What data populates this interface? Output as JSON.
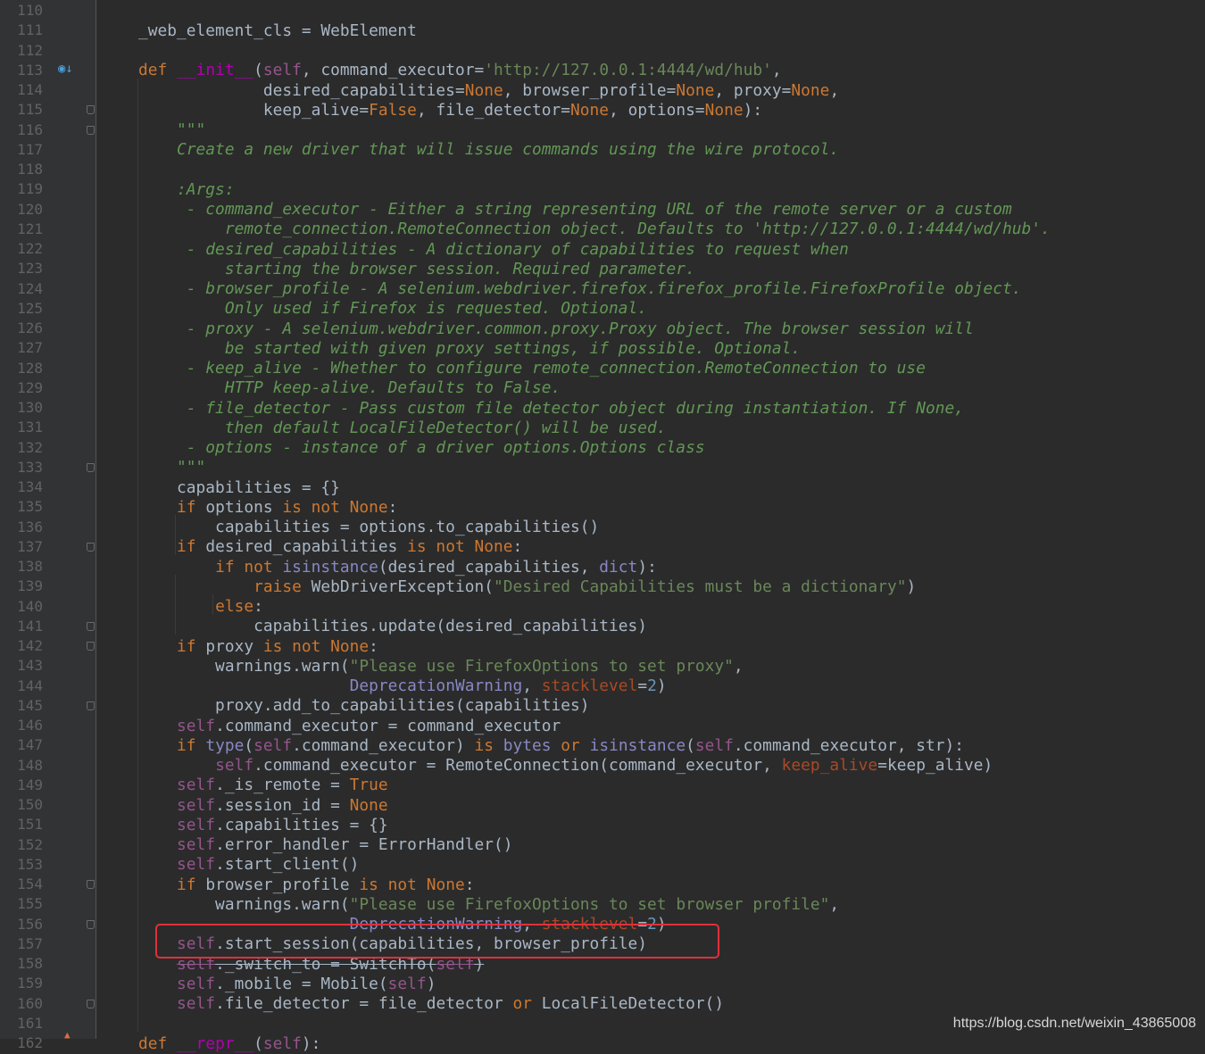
{
  "editor": {
    "language": "python",
    "theme": "darcula",
    "highlighted_line": 157,
    "lines": [
      {
        "n": "110",
        "t": [
          {
            "s": ""
          }
        ]
      },
      {
        "n": "111",
        "t": [
          {
            "s": "    _web_element_cls = WebElement"
          }
        ]
      },
      {
        "n": "112",
        "t": [
          {
            "s": ""
          }
        ]
      },
      {
        "n": "113",
        "t": [
          {
            "s": "    "
          },
          {
            "s": "def ",
            "c": "kw"
          },
          {
            "s": "__init__",
            "c": "dunder"
          },
          {
            "s": "("
          },
          {
            "s": "self",
            "c": "self"
          },
          {
            "s": ", command_executor="
          },
          {
            "s": "'http://127.0.0.1:4444/wd/hub'",
            "c": "str"
          },
          {
            "s": ","
          }
        ]
      },
      {
        "n": "114",
        "t": [
          {
            "s": "                 desired_capabilities="
          },
          {
            "s": "None",
            "c": "kw"
          },
          {
            "s": ", browser_profile="
          },
          {
            "s": "None",
            "c": "kw"
          },
          {
            "s": ", proxy="
          },
          {
            "s": "None",
            "c": "kw"
          },
          {
            "s": ","
          }
        ]
      },
      {
        "n": "115",
        "t": [
          {
            "s": "                 keep_alive="
          },
          {
            "s": "False",
            "c": "kw"
          },
          {
            "s": ", file_detector="
          },
          {
            "s": "None",
            "c": "kw"
          },
          {
            "s": ", options="
          },
          {
            "s": "None",
            "c": "kw"
          },
          {
            "s": "):"
          }
        ]
      },
      {
        "n": "116",
        "t": [
          {
            "s": "        "
          },
          {
            "s": "\"\"\"",
            "c": "doc"
          }
        ]
      },
      {
        "n": "117",
        "t": [
          {
            "s": "        Create a new driver that will issue commands using the wire protocol.",
            "c": "doc"
          }
        ]
      },
      {
        "n": "118",
        "t": [
          {
            "s": ""
          }
        ]
      },
      {
        "n": "119",
        "t": [
          {
            "s": "        :Args:",
            "c": "doc"
          }
        ]
      },
      {
        "n": "120",
        "t": [
          {
            "s": "         - command_executor - Either a string representing URL of the remote server or a custom",
            "c": "doc"
          }
        ]
      },
      {
        "n": "121",
        "t": [
          {
            "s": "             remote_connection.RemoteConnection object. Defaults to 'http://127.0.0.1:4444/wd/hub'.",
            "c": "doc"
          }
        ]
      },
      {
        "n": "122",
        "t": [
          {
            "s": "         - desired_capabilities - A dictionary of capabilities to request when",
            "c": "doc"
          }
        ]
      },
      {
        "n": "123",
        "t": [
          {
            "s": "             starting the browser session. Required parameter.",
            "c": "doc"
          }
        ]
      },
      {
        "n": "124",
        "t": [
          {
            "s": "         - browser_profile - A selenium.webdriver.firefox.firefox_profile.FirefoxProfile object.",
            "c": "doc"
          }
        ]
      },
      {
        "n": "125",
        "t": [
          {
            "s": "             Only used if Firefox is requested. Optional.",
            "c": "doc"
          }
        ]
      },
      {
        "n": "126",
        "t": [
          {
            "s": "         - proxy - A selenium.webdriver.common.proxy.Proxy object. The browser session will",
            "c": "doc"
          }
        ]
      },
      {
        "n": "127",
        "t": [
          {
            "s": "             be started with given proxy settings, if possible. Optional.",
            "c": "doc"
          }
        ]
      },
      {
        "n": "128",
        "t": [
          {
            "s": "         - keep_alive - Whether to configure remote_connection.RemoteConnection to use",
            "c": "doc"
          }
        ]
      },
      {
        "n": "129",
        "t": [
          {
            "s": "             HTTP keep-alive. Defaults to False.",
            "c": "doc"
          }
        ]
      },
      {
        "n": "130",
        "t": [
          {
            "s": "         - file_detector - Pass custom file detector object during instantiation. If None,",
            "c": "doc"
          }
        ]
      },
      {
        "n": "131",
        "t": [
          {
            "s": "             then default LocalFileDetector() will be used.",
            "c": "doc"
          }
        ]
      },
      {
        "n": "132",
        "t": [
          {
            "s": "         - options - instance of a driver options.Options class",
            "c": "doc"
          }
        ]
      },
      {
        "n": "133",
        "t": [
          {
            "s": "        "
          },
          {
            "s": "\"\"\"",
            "c": "doc"
          }
        ]
      },
      {
        "n": "134",
        "t": [
          {
            "s": "        capabilities = {}"
          }
        ]
      },
      {
        "n": "135",
        "t": [
          {
            "s": "        "
          },
          {
            "s": "if ",
            "c": "kw"
          },
          {
            "s": "options "
          },
          {
            "s": "is not None",
            "c": "kw"
          },
          {
            "s": ":"
          }
        ]
      },
      {
        "n": "136",
        "t": [
          {
            "s": "            capabilities = options.to_capabilities()"
          }
        ]
      },
      {
        "n": "137",
        "t": [
          {
            "s": "        "
          },
          {
            "s": "if ",
            "c": "kw"
          },
          {
            "s": "desired_capabilities "
          },
          {
            "s": "is not None",
            "c": "kw"
          },
          {
            "s": ":"
          }
        ]
      },
      {
        "n": "138",
        "t": [
          {
            "s": "            "
          },
          {
            "s": "if not ",
            "c": "kw"
          },
          {
            "s": "isinstance",
            "c": "bi"
          },
          {
            "s": "(desired_capabilities, "
          },
          {
            "s": "dict",
            "c": "bi"
          },
          {
            "s": "):"
          }
        ]
      },
      {
        "n": "139",
        "t": [
          {
            "s": "                "
          },
          {
            "s": "raise ",
            "c": "kw"
          },
          {
            "s": "WebDriverException("
          },
          {
            "s": "\"Desired Capabilities must be a dictionary\"",
            "c": "str"
          },
          {
            "s": ")"
          }
        ]
      },
      {
        "n": "140",
        "t": [
          {
            "s": "            "
          },
          {
            "s": "else",
            "c": "kw"
          },
          {
            "s": ":"
          }
        ]
      },
      {
        "n": "141",
        "t": [
          {
            "s": "                capabilities.update(desired_capabilities)"
          }
        ]
      },
      {
        "n": "142",
        "t": [
          {
            "s": "        "
          },
          {
            "s": "if ",
            "c": "kw"
          },
          {
            "s": "proxy "
          },
          {
            "s": "is not None",
            "c": "kw"
          },
          {
            "s": ":"
          }
        ]
      },
      {
        "n": "143",
        "t": [
          {
            "s": "            warnings.warn("
          },
          {
            "s": "\"Please use FirefoxOptions to set proxy\"",
            "c": "str"
          },
          {
            "s": ","
          }
        ]
      },
      {
        "n": "144",
        "t": [
          {
            "s": "                          "
          },
          {
            "s": "DeprecationWarning",
            "c": "bi"
          },
          {
            "s": ", "
          },
          {
            "s": "stacklevel",
            "c": "kwarg"
          },
          {
            "s": "="
          },
          {
            "s": "2",
            "c": "num"
          },
          {
            "s": ")"
          }
        ]
      },
      {
        "n": "145",
        "t": [
          {
            "s": "            proxy.add_to_capabilities(capabilities)"
          }
        ]
      },
      {
        "n": "146",
        "t": [
          {
            "s": "        "
          },
          {
            "s": "self",
            "c": "self"
          },
          {
            "s": ".command_executor = command_executor"
          }
        ]
      },
      {
        "n": "147",
        "t": [
          {
            "s": "        "
          },
          {
            "s": "if ",
            "c": "kw"
          },
          {
            "s": "type",
            "c": "bi"
          },
          {
            "s": "("
          },
          {
            "s": "self",
            "c": "self"
          },
          {
            "s": ".command_executor) "
          },
          {
            "s": "is ",
            "c": "kw"
          },
          {
            "s": "bytes ",
            "c": "bi"
          },
          {
            "s": "or ",
            "c": "kw"
          },
          {
            "s": "isinstance",
            "c": "bi"
          },
          {
            "s": "("
          },
          {
            "s": "self",
            "c": "self"
          },
          {
            "s": ".command_executor, str):"
          }
        ]
      },
      {
        "n": "148",
        "t": [
          {
            "s": "            "
          },
          {
            "s": "self",
            "c": "self"
          },
          {
            "s": ".command_executor = RemoteConnection(command_executor, "
          },
          {
            "s": "keep_alive",
            "c": "kwarg"
          },
          {
            "s": "=keep_alive)"
          }
        ]
      },
      {
        "n": "149",
        "t": [
          {
            "s": "        "
          },
          {
            "s": "self",
            "c": "self"
          },
          {
            "s": "._is_remote = "
          },
          {
            "s": "True",
            "c": "kw"
          }
        ]
      },
      {
        "n": "150",
        "t": [
          {
            "s": "        "
          },
          {
            "s": "self",
            "c": "self"
          },
          {
            "s": ".session_id = "
          },
          {
            "s": "None",
            "c": "kw"
          }
        ]
      },
      {
        "n": "151",
        "t": [
          {
            "s": "        "
          },
          {
            "s": "self",
            "c": "self"
          },
          {
            "s": ".capabilities = {}"
          }
        ]
      },
      {
        "n": "152",
        "t": [
          {
            "s": "        "
          },
          {
            "s": "self",
            "c": "self"
          },
          {
            "s": ".error_handler = ErrorHandler()"
          }
        ]
      },
      {
        "n": "153",
        "t": [
          {
            "s": "        "
          },
          {
            "s": "self",
            "c": "self"
          },
          {
            "s": ".start_client()"
          }
        ]
      },
      {
        "n": "154",
        "t": [
          {
            "s": "        "
          },
          {
            "s": "if ",
            "c": "kw"
          },
          {
            "s": "browser_profile "
          },
          {
            "s": "is not None",
            "c": "kw"
          },
          {
            "s": ":"
          }
        ]
      },
      {
        "n": "155",
        "t": [
          {
            "s": "            warnings.warn("
          },
          {
            "s": "\"Please use FirefoxOptions to set browser profile\"",
            "c": "str"
          },
          {
            "s": ","
          }
        ]
      },
      {
        "n": "156",
        "t": [
          {
            "s": "                          "
          },
          {
            "s": "DeprecationWarning",
            "c": "bi strike"
          },
          {
            "s": ", ",
            "c": "strike"
          },
          {
            "s": "stacklevel",
            "c": "kwarg strike"
          },
          {
            "s": "=",
            "c": "strike"
          },
          {
            "s": "2",
            "c": "num strike"
          },
          {
            "s": ")"
          }
        ]
      },
      {
        "n": "157",
        "t": [
          {
            "s": "        "
          },
          {
            "s": "self",
            "c": "self"
          },
          {
            "s": ".start_session(capabilities, browser_profile)"
          }
        ]
      },
      {
        "n": "158",
        "t": [
          {
            "s": "        "
          },
          {
            "s": "self",
            "c": "self strike"
          },
          {
            "s": "._switch_to = SwitchTo(",
            "c": "strike"
          },
          {
            "s": "self",
            "c": "self strike"
          },
          {
            "s": ")",
            "c": "strike"
          }
        ]
      },
      {
        "n": "159",
        "t": [
          {
            "s": "        "
          },
          {
            "s": "self",
            "c": "self"
          },
          {
            "s": "._mobile = Mobile("
          },
          {
            "s": "self",
            "c": "self"
          },
          {
            "s": ")"
          }
        ]
      },
      {
        "n": "160",
        "t": [
          {
            "s": "        "
          },
          {
            "s": "self",
            "c": "self"
          },
          {
            "s": ".file_detector = file_detector "
          },
          {
            "s": "or ",
            "c": "kw"
          },
          {
            "s": "LocalFileDetector()"
          }
        ]
      },
      {
        "n": "161",
        "t": [
          {
            "s": ""
          }
        ]
      },
      {
        "n": "162",
        "t": [
          {
            "s": "    "
          },
          {
            "s": "def ",
            "c": "kw"
          },
          {
            "s": "__repr__",
            "c": "dunder"
          },
          {
            "s": "("
          },
          {
            "s": "self",
            "c": "self"
          },
          {
            "s": "):"
          }
        ]
      }
    ],
    "fold_markers_at_lines": [
      115,
      116,
      133,
      137,
      141,
      142,
      145,
      154,
      156,
      160
    ]
  },
  "gutter_icons": {
    "line_113": "override-method-icon",
    "line_162": "override-arrow-icon"
  },
  "watermark": "https://blog.csdn.net/weixin_43865008"
}
